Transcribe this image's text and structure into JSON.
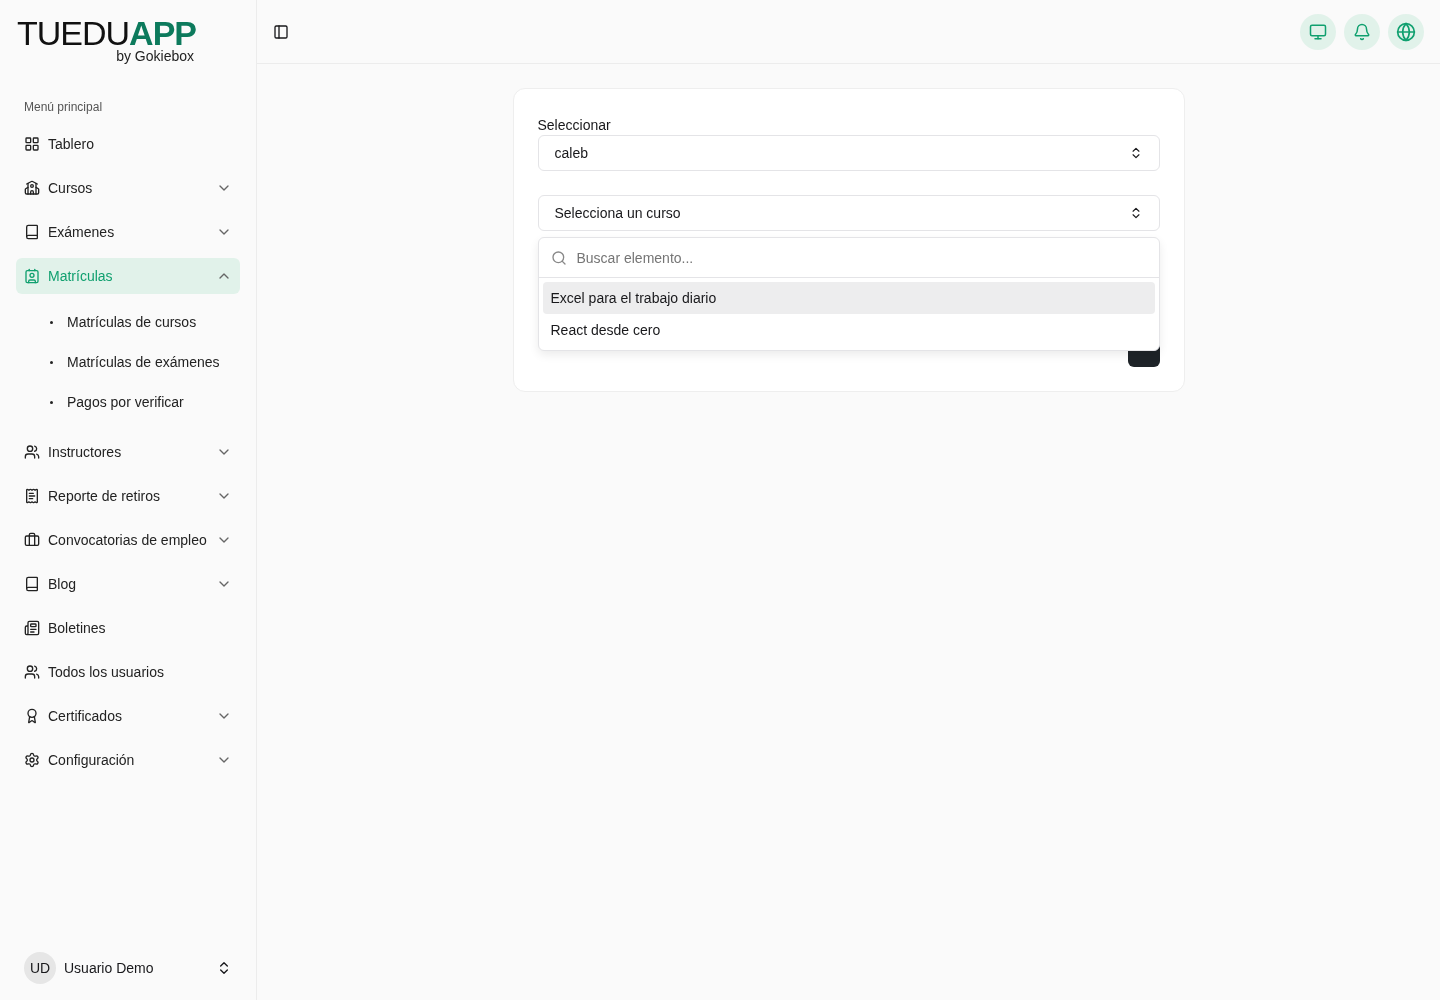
{
  "logo": {
    "word": "TUEDU",
    "accent": "APP",
    "tagline": "by Gokiebox"
  },
  "sidebar": {
    "section_label": "Menú principal",
    "items": [
      {
        "label": "Tablero",
        "selected": false
      },
      {
        "label": "Cursos",
        "selected": false,
        "expanded": false
      },
      {
        "label": "Exámenes",
        "selected": false,
        "expanded": false
      },
      {
        "label": "Matrículas",
        "selected": true,
        "expanded": true,
        "children": [
          {
            "label": "Matrículas de cursos"
          },
          {
            "label": "Matrículas de exámenes"
          },
          {
            "label": "Pagos por verificar"
          }
        ]
      },
      {
        "label": "Instructores",
        "selected": false,
        "expanded": false
      },
      {
        "label": "Reporte de retiros",
        "selected": false,
        "expanded": false
      },
      {
        "label": "Convocatorias de empleo",
        "selected": false,
        "expanded": false
      },
      {
        "label": "Blog",
        "selected": false,
        "expanded": false
      },
      {
        "label": "Boletines",
        "selected": false
      },
      {
        "label": "Todos los usuarios",
        "selected": false
      },
      {
        "label": "Certificados",
        "selected": false,
        "expanded": false
      },
      {
        "label": "Configuración",
        "selected": false,
        "expanded": false
      }
    ],
    "user": {
      "initials": "UD",
      "name": "Usuario Demo"
    }
  },
  "form": {
    "user_label": "Seleccionar",
    "user_value": "caleb",
    "course_value": "Selecciona un curso",
    "dropdown": {
      "placeholder": "Buscar elemento...",
      "options": [
        {
          "label": "Excel para el trabajo diario",
          "selected": true
        },
        {
          "label": "React desde cero",
          "selected": false
        }
      ]
    }
  }
}
